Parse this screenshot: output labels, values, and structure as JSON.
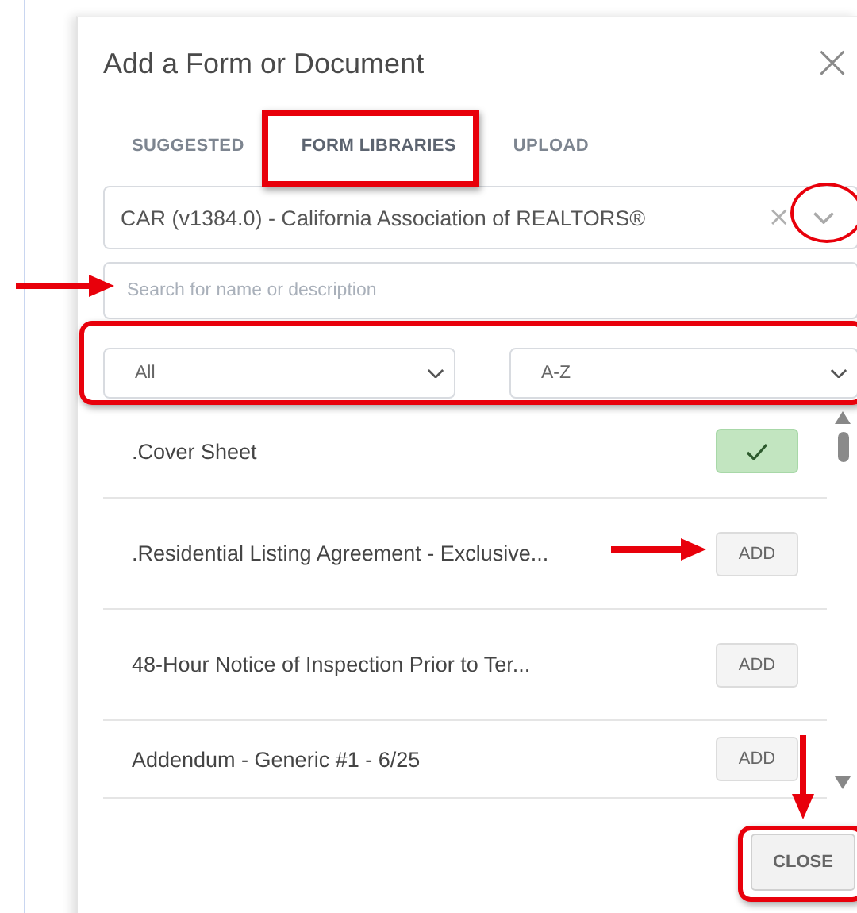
{
  "dialog": {
    "title": "Add a Form or Document",
    "close_icon": "×"
  },
  "tabs": [
    {
      "label": "SUGGESTED",
      "selected": false
    },
    {
      "label": "FORM LIBRARIES",
      "selected": true
    },
    {
      "label": "UPLOAD",
      "selected": false
    }
  ],
  "library_select": {
    "value": "CAR (v1384.0) - California Association of REALTORS®",
    "clear": "×"
  },
  "search": {
    "placeholder": "Search for name or description"
  },
  "filters": [
    {
      "value": "All"
    },
    {
      "value": "A-Z"
    }
  ],
  "forms": [
    {
      "name": ".Cover Sheet",
      "added": true
    },
    {
      "name": ".Residential Listing Agreement - Exclusive...",
      "added": false,
      "button": "ADD"
    },
    {
      "name": "48-Hour Notice of Inspection Prior to Ter...",
      "added": false,
      "button": "ADD"
    },
    {
      "name": "Addendum - Generic #1 - 6/25",
      "added": false,
      "button": "ADD"
    }
  ],
  "footer": {
    "button": "CLOSE"
  }
}
